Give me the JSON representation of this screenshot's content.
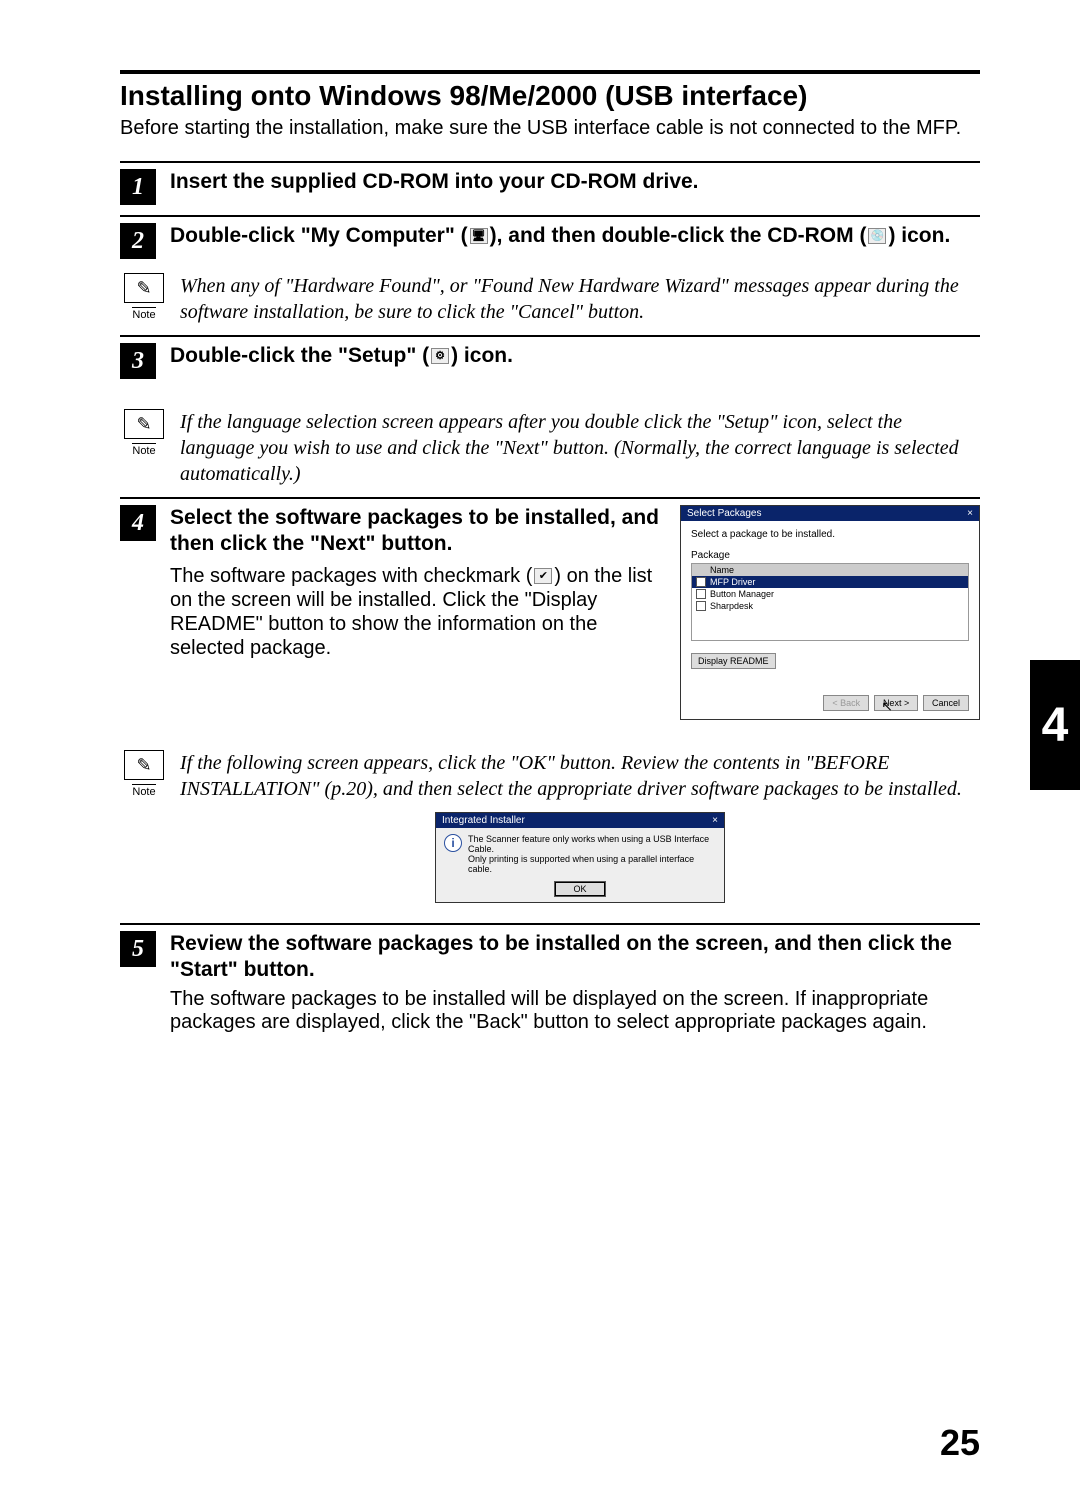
{
  "title": "Installing onto Windows 98/Me/2000 (USB interface)",
  "intro": "Before starting the installation, make sure the USB interface cable is not connected to the MFP.",
  "steps": {
    "s1": {
      "num": "1",
      "text": "Insert the supplied CD-ROM into your CD-ROM drive."
    },
    "s2": {
      "num": "2",
      "text_a": "Double-click \"My Computer\" (",
      "text_b": "), and then double-click the CD-ROM (",
      "text_c": ") icon."
    },
    "s3": {
      "num": "3",
      "text_a": "Double-click the \"Setup\" (",
      "text_b": ") icon."
    },
    "s4": {
      "num": "4",
      "heading": "Select the software packages to be installed, and then click the \"Next\" button.",
      "body_a": "The software packages with checkmark (",
      "body_b": ") on the list on the screen will be installed. Click the \"Display README\" button to show the information on the selected package."
    },
    "s5": {
      "num": "5",
      "heading": "Review the software packages to be installed on the screen, and then click the \"Start\" button.",
      "body": "The software packages to be installed will be displayed on the screen. If inappropriate packages are displayed, click the \"Back\" button to select appropriate packages again."
    }
  },
  "notes": {
    "label": "Note",
    "n1": "When any of \"Hardware Found\", or \"Found New Hardware Wizard\" messages appear during the software installation, be sure to click the \"Cancel\" button.",
    "n2": "If the language selection screen appears after you double click the \"Setup\" icon, select the language you wish to use and click the \"Next\" button. (Normally, the correct language is selected automatically.)",
    "n3": "If the following screen appears, click the \"OK\" button. Review the contents in \"BEFORE INSTALLATION\" (p.20), and then select the appropriate driver software packages to be installed."
  },
  "installer": {
    "title": "Select Packages",
    "subtitle": "Select a package to be installed.",
    "pkg_label": "Package",
    "col_name": "Name",
    "rows": [
      "MFP Driver",
      "Button Manager",
      "Sharpdesk"
    ],
    "readme": "Display README",
    "back": "< Back",
    "next": "Next >",
    "cancel": "Cancel"
  },
  "msgbox": {
    "title": "Integrated Installer",
    "line1": "The Scanner feature only works when using a USB Interface Cable.",
    "line2": "Only printing is supported when using a parallel interface cable.",
    "ok": "OK"
  },
  "chapter": "4",
  "page": "25",
  "icons": {
    "note_glyph": "✎",
    "mycomputer": "🖥",
    "cdrom": "💿",
    "setup": "⚙",
    "check": "✔",
    "close": "×"
  }
}
